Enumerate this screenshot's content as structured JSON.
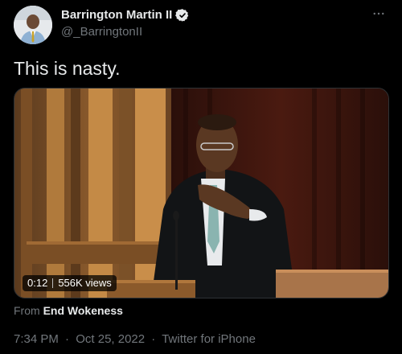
{
  "author": {
    "display_name": "Barrington Martin II",
    "handle": "@_BarringtonII"
  },
  "icons": {
    "verified": "verified-badge-icon",
    "more": "more-options-icon"
  },
  "tweet": {
    "text": "This is nasty."
  },
  "media": {
    "duration": "0:12",
    "views": "556K views"
  },
  "source": {
    "prefix": "From",
    "account": "End Wokeness"
  },
  "meta": {
    "time": "7:34 PM",
    "date": "Oct 25, 2022",
    "separator": "·",
    "client": "Twitter for iPhone"
  },
  "colors": {
    "background": "#000000",
    "text": "#e7e9ea",
    "muted": "#71767b",
    "verified": "#1d9bf0"
  }
}
